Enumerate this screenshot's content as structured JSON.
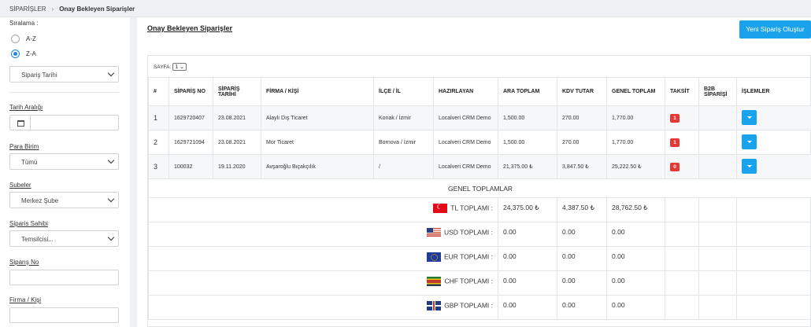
{
  "breadcrumb": {
    "root": "SİPARİŞLER",
    "separator": "›",
    "current": "Onay Bekleyen Siparişler"
  },
  "sidebar": {
    "sort_label": "Sıralama :",
    "sort_options": [
      "A-Z",
      "Z-A"
    ],
    "sort_selected": "Z-A",
    "sort_field": "Sipariş Tarihi",
    "date_range_label": "Tarih Aralığı",
    "currency_label": "Para Birim",
    "currency_value": "Tümü",
    "branches_label": "Subeler",
    "branch_value": "Merkez Şube",
    "owner_label": "Siparis Sahibi",
    "owner_value": "Temsilcisi...",
    "order_no_label": "Siparış No",
    "company_label": "Firma / Kişi"
  },
  "main": {
    "title": "Onay Bekleyen Siparişler",
    "new_button": "Yeni Sipariş Oluştur",
    "page_label": "SAYFA:",
    "page_value": "1"
  },
  "table": {
    "headers": [
      "#",
      "SİPARİŞ NO",
      "SİPARİŞ TARİHİ",
      "FİRMA / KİŞİ",
      "İLÇE / İL",
      "HAZIRLAYAN",
      "ARA TOPLAM",
      "KDV TUTAR",
      "GENEL TOPLAM",
      "TAKSİT",
      "B2B SİPARİŞİ",
      "İŞLEMLER"
    ],
    "rows": [
      {
        "idx": "1",
        "no": "1629720407",
        "date": "23.08.2021",
        "company": "Alaylı Dış Ticaret",
        "city": "Konak / İzmir",
        "prep": "Localveri CRM Demo",
        "sub": "1,500.00",
        "vat": "270.00",
        "total": "1,770.00",
        "taksit": "1"
      },
      {
        "idx": "2",
        "no": "1629721094",
        "date": "23.08.2021",
        "company": "Mor Ticaret",
        "city": "Bornova / İzmir",
        "prep": "Localveri CRM Demo",
        "sub": "1,500.00",
        "vat": "270.00",
        "total": "1,770.00",
        "taksit": "1"
      },
      {
        "idx": "3",
        "no": "100032",
        "date": "19.11.2020",
        "company": "Avşaroğlu Bıçakçılık",
        "city": "/",
        "prep": "Localveri CRM Demo",
        "sub": "21,375.00 ₺",
        "vat": "3,847.50 ₺",
        "total": "25,222.50 ₺",
        "taksit": "0"
      }
    ],
    "totals_title": "GENEL TOPLAMLAR",
    "totals": [
      {
        "label": "TL TOPLAMI :",
        "sub": "24,375.00 ₺",
        "vat": "4,387.50 ₺",
        "total": "28,762.50 ₺"
      },
      {
        "label": "USD TOPLAMI :",
        "sub": "0.00",
        "vat": "0.00",
        "total": "0.00"
      },
      {
        "label": "EUR TOPLAMI :",
        "sub": "0.00",
        "vat": "0.00",
        "total": "0.00"
      },
      {
        "label": "CHF TOPLAMI :",
        "sub": "0.00",
        "vat": "0.00",
        "total": "0.00"
      },
      {
        "label": "GBP TOPLAMI :",
        "sub": "0.00",
        "vat": "0.00",
        "total": "0.00"
      }
    ]
  },
  "colors": {
    "accent": "#1aa3ec",
    "badge": "#e53935"
  }
}
